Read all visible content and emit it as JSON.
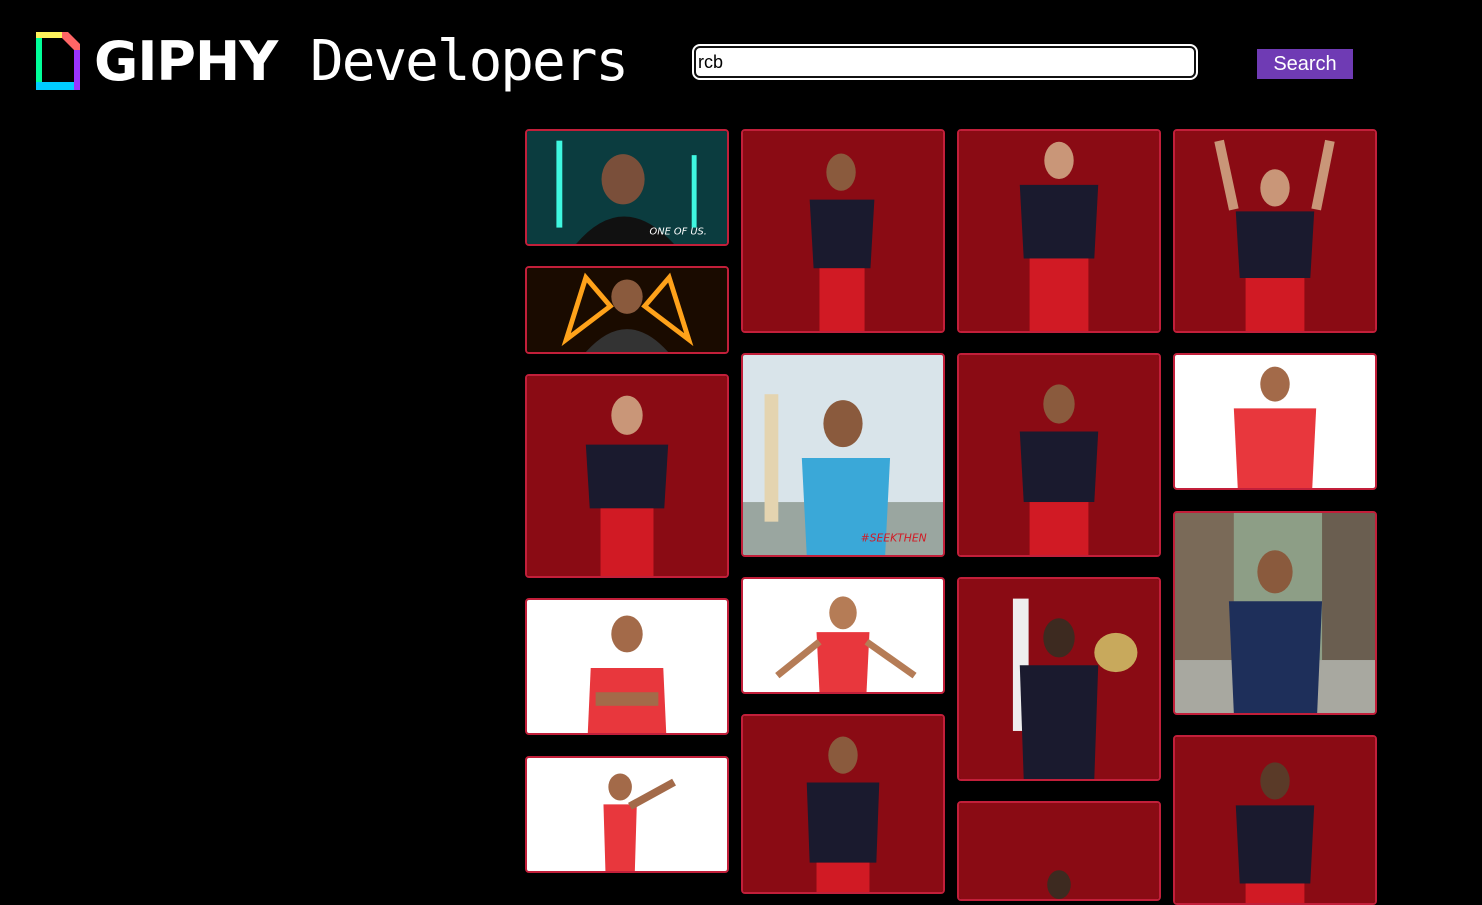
{
  "header": {
    "logo_icon": "giphy-logo-icon",
    "logo_word": "GIPHY",
    "logo_sub": "Developers",
    "search_value": "rcb",
    "search_button_label": "Search"
  },
  "colors": {
    "background": "#000000",
    "accent_button": "#6f3bb4",
    "tile_border": "#c21f3a",
    "rcb_red": "#b0101c",
    "teal": "#0e5f5f"
  },
  "gif_tiles": [
    {
      "name": "gif-tile-kohli-teal",
      "overlay": "ONE OF US."
    },
    {
      "name": "gif-tile-kohli-neon",
      "overlay": ""
    },
    {
      "name": "gif-tile-duplessis",
      "overlay": ""
    },
    {
      "name": "gif-tile-kohli-mpl-arms-crossed",
      "overlay": ""
    },
    {
      "name": "gif-tile-kohli-mpl-pose",
      "overlay": ""
    },
    {
      "name": "gif-tile-rcb-player-1",
      "overlay": ""
    },
    {
      "name": "gif-tile-kohli-india-bat",
      "overlay": "#SEEKTHEN"
    },
    {
      "name": "gif-tile-mpl-player-stretch",
      "overlay": ""
    },
    {
      "name": "gif-tile-rcb-player-arms-crossed",
      "overlay": ""
    },
    {
      "name": "gif-tile-rcb-player-2",
      "overlay": ""
    },
    {
      "name": "gif-tile-rcb-player-harshal",
      "overlay": ""
    },
    {
      "name": "gif-tile-rcb-player-bat-helmet",
      "overlay": ""
    },
    {
      "name": "gif-tile-rcb-player-3",
      "overlay": ""
    },
    {
      "name": "gif-tile-rcb-player-4",
      "overlay": ""
    },
    {
      "name": "gif-tile-kohli-mpl-hands-hips",
      "overlay": ""
    },
    {
      "name": "gif-tile-kohli-street",
      "overlay": ""
    },
    {
      "name": "gif-tile-rcb-player-5",
      "overlay": ""
    }
  ]
}
